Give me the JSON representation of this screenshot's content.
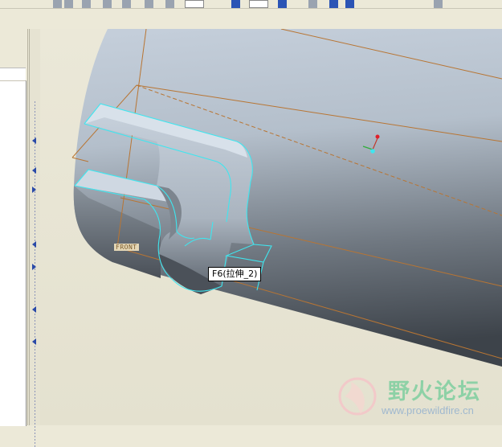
{
  "toolbar": {
    "icons": [
      "undo-icon",
      "redo-icon",
      "new-icon",
      "open-icon",
      "save-icon",
      "print-icon",
      "views-icon",
      "repaint-icon",
      "zoom-icon",
      "spin-icon",
      "datum-plane-icon",
      "datum-axis-icon",
      "datum-point-icon",
      "csys-icon",
      "analysis-icon"
    ]
  },
  "model_tree": {
    "title": ""
  },
  "viewport": {
    "plane_label": "FRONT",
    "feature_tooltip": "F6(拉伸_2)",
    "colors": {
      "background": "#eae7d6",
      "edge_highlight": "#3fe6ef",
      "datum": "#b87533"
    }
  },
  "watermark": {
    "title": "野火论坛",
    "url": "www.proewildfire.cn"
  }
}
